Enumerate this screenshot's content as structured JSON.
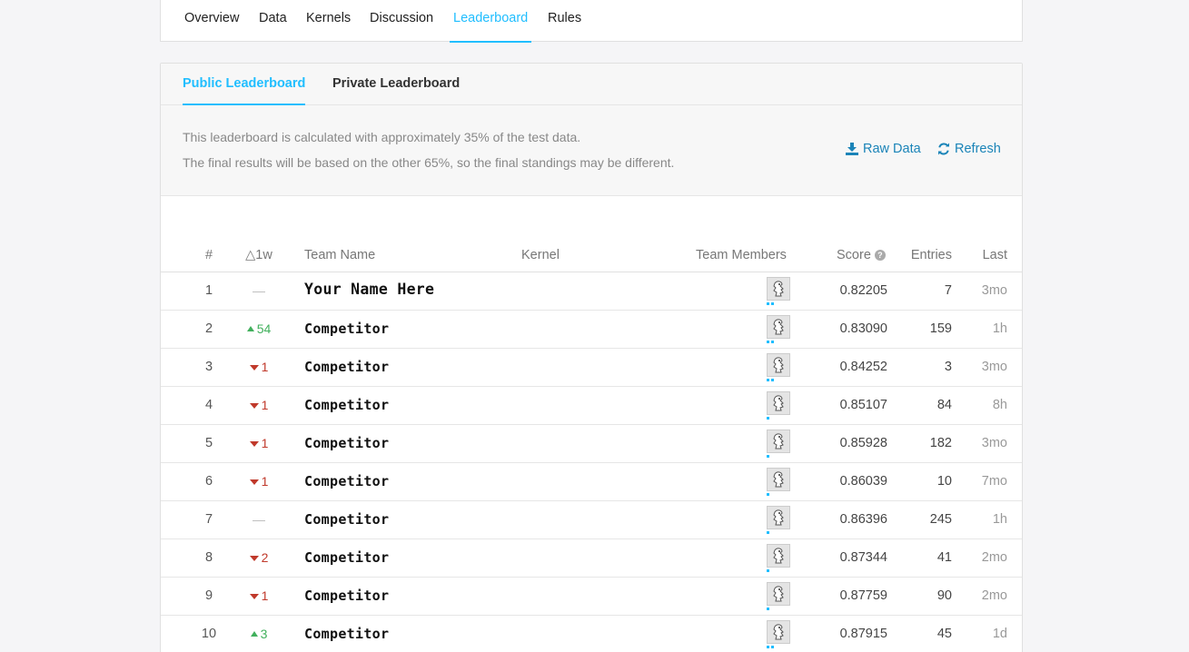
{
  "nav": {
    "tabs": [
      {
        "label": "Overview",
        "active": false
      },
      {
        "label": "Data",
        "active": false
      },
      {
        "label": "Kernels",
        "active": false
      },
      {
        "label": "Discussion",
        "active": false
      },
      {
        "label": "Leaderboard",
        "active": true
      },
      {
        "label": "Rules",
        "active": false
      }
    ]
  },
  "leaderboard": {
    "tabs": [
      {
        "label": "Public Leaderboard",
        "active": true
      },
      {
        "label": "Private Leaderboard",
        "active": false
      }
    ],
    "info_line1": "This leaderboard is calculated with approximately 35% of the test data.",
    "info_line2": "The final results will be based on the other 65%, so the final standings may be different.",
    "raw_data_label": "Raw Data",
    "refresh_label": "Refresh",
    "icons": {
      "raw_data": "download-icon",
      "refresh": "refresh-icon",
      "score_help": "question-circle-icon",
      "member": "member-avatar-icon"
    },
    "colors": {
      "accent": "#20beff",
      "link": "#1a84b8",
      "up": "#41b05c",
      "down": "#c0392b"
    },
    "columns": {
      "rank": "#",
      "delta": "△1w",
      "team": "Team Name",
      "kernel": "Kernel",
      "members": "Team Members",
      "score": "Score",
      "entries": "Entries",
      "last": "Last"
    },
    "rows": [
      {
        "rank": "1",
        "delta": "—",
        "delta_dir": "none",
        "team": "Your Name Here",
        "member_dots": 2,
        "score": "0.82205",
        "entries": "7",
        "last": "3mo"
      },
      {
        "rank": "2",
        "delta": "54",
        "delta_dir": "up",
        "team": "Competitor",
        "member_dots": 2,
        "score": "0.83090",
        "entries": "159",
        "last": "1h"
      },
      {
        "rank": "3",
        "delta": "1",
        "delta_dir": "down",
        "team": "Competitor",
        "member_dots": 2,
        "score": "0.84252",
        "entries": "3",
        "last": "3mo"
      },
      {
        "rank": "4",
        "delta": "1",
        "delta_dir": "down",
        "team": "Competitor",
        "member_dots": 1,
        "score": "0.85107",
        "entries": "84",
        "last": "8h"
      },
      {
        "rank": "5",
        "delta": "1",
        "delta_dir": "down",
        "team": "Competitor",
        "member_dots": 1,
        "score": "0.85928",
        "entries": "182",
        "last": "3mo"
      },
      {
        "rank": "6",
        "delta": "1",
        "delta_dir": "down",
        "team": "Competitor",
        "member_dots": 1,
        "score": "0.86039",
        "entries": "10",
        "last": "7mo"
      },
      {
        "rank": "7",
        "delta": "—",
        "delta_dir": "none",
        "team": "Competitor",
        "member_dots": 1,
        "score": "0.86396",
        "entries": "245",
        "last": "1h"
      },
      {
        "rank": "8",
        "delta": "2",
        "delta_dir": "down",
        "team": "Competitor",
        "member_dots": 1,
        "score": "0.87344",
        "entries": "41",
        "last": "2mo"
      },
      {
        "rank": "9",
        "delta": "1",
        "delta_dir": "down",
        "team": "Competitor",
        "member_dots": 1,
        "score": "0.87759",
        "entries": "90",
        "last": "2mo"
      },
      {
        "rank": "10",
        "delta": "3",
        "delta_dir": "up",
        "team": "Competitor",
        "member_dots": 2,
        "score": "0.87915",
        "entries": "45",
        "last": "1d"
      }
    ]
  }
}
